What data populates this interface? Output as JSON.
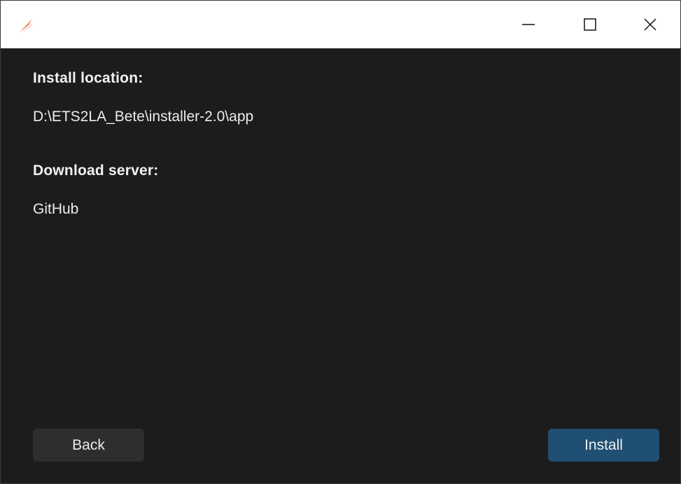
{
  "window": {
    "icon": "ets2la-feather-icon",
    "controls": {
      "minimize_icon": "minimize-icon",
      "maximize_icon": "maximize-icon",
      "close_icon": "close-icon"
    }
  },
  "summary": {
    "install_location_label": "Install location:",
    "install_location_value": "D:\\ETS2LA_Bete\\installer-2.0\\app",
    "download_server_label": "Download server:",
    "download_server_value": "GitHub"
  },
  "buttons": {
    "back_label": "Back",
    "install_label": "Install"
  },
  "colors": {
    "background": "#1c1c1c",
    "accent": "#1f4f73",
    "secondary_button": "#2e2e31",
    "icon_accent": "#e8764f"
  }
}
